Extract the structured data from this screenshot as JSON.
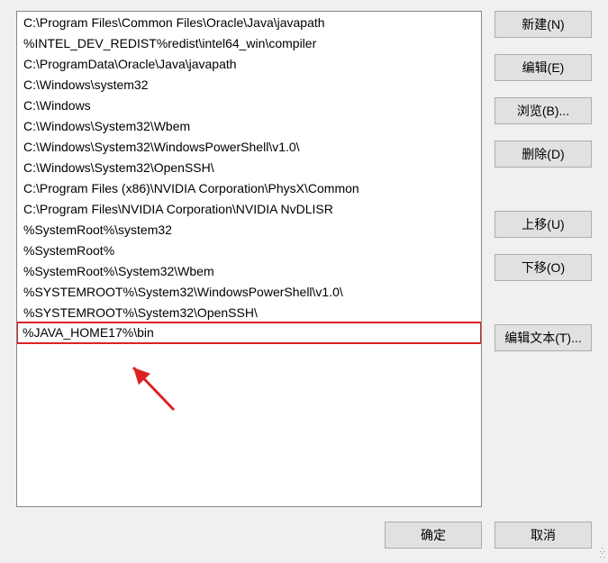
{
  "paths": [
    "C:\\Program Files\\Common Files\\Oracle\\Java\\javapath",
    "%INTEL_DEV_REDIST%redist\\intel64_win\\compiler",
    "C:\\ProgramData\\Oracle\\Java\\javapath",
    "C:\\Windows\\system32",
    "C:\\Windows",
    "C:\\Windows\\System32\\Wbem",
    "C:\\Windows\\System32\\WindowsPowerShell\\v1.0\\",
    "C:\\Windows\\System32\\OpenSSH\\",
    "C:\\Program Files (x86)\\NVIDIA Corporation\\PhysX\\Common",
    "C:\\Program Files\\NVIDIA Corporation\\NVIDIA NvDLISR",
    "%SystemRoot%\\system32",
    "%SystemRoot%",
    "%SystemRoot%\\System32\\Wbem",
    "%SYSTEMROOT%\\System32\\WindowsPowerShell\\v1.0\\",
    "%SYSTEMROOT%\\System32\\OpenSSH\\",
    "%JAVA_HOME17%\\bin"
  ],
  "highlighted_index": 15,
  "buttons": {
    "new": "新建(N)",
    "edit": "编辑(E)",
    "browse": "浏览(B)...",
    "delete": "删除(D)",
    "move_up": "上移(U)",
    "move_down": "下移(O)",
    "edit_text": "编辑文本(T)...",
    "ok": "确定",
    "cancel": "取消"
  }
}
